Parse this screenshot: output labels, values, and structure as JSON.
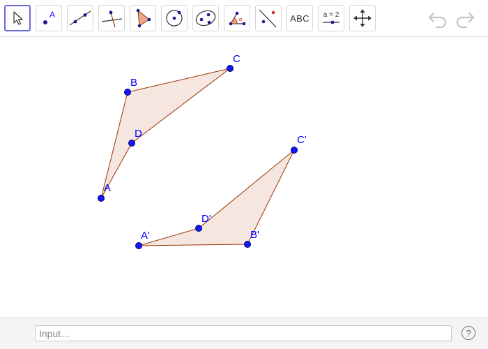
{
  "toolbar": {
    "tools": [
      {
        "name": "move-tool"
      },
      {
        "name": "point-tool",
        "label": "A"
      },
      {
        "name": "line-tool"
      },
      {
        "name": "perpendicular-line-tool"
      },
      {
        "name": "polygon-tool"
      },
      {
        "name": "circle-center-point-tool"
      },
      {
        "name": "conic-tool"
      },
      {
        "name": "angle-tool"
      },
      {
        "name": "reflect-about-line-tool"
      },
      {
        "name": "text-tool",
        "label": "ABC"
      },
      {
        "name": "slider-tool",
        "label": "a = 2"
      },
      {
        "name": "move-graphics-view-tool"
      }
    ],
    "selected_tool": "move-tool"
  },
  "canvas": {
    "colors": {
      "point_fill": "#1414ff",
      "point_stroke": "#000066",
      "polygon_fill": "#f6e6e0",
      "polygon_stroke": "#993300",
      "label": "#0000ff"
    },
    "labels": {
      "A": "A",
      "B": "B",
      "C": "C",
      "D": "D",
      "A_prime": "A'",
      "B_prime": "B'",
      "C_prime": "C'",
      "D_prime": "D'"
    }
  },
  "input_bar": {
    "placeholder": "Input…",
    "value": ""
  },
  "help": {
    "label": "?"
  }
}
